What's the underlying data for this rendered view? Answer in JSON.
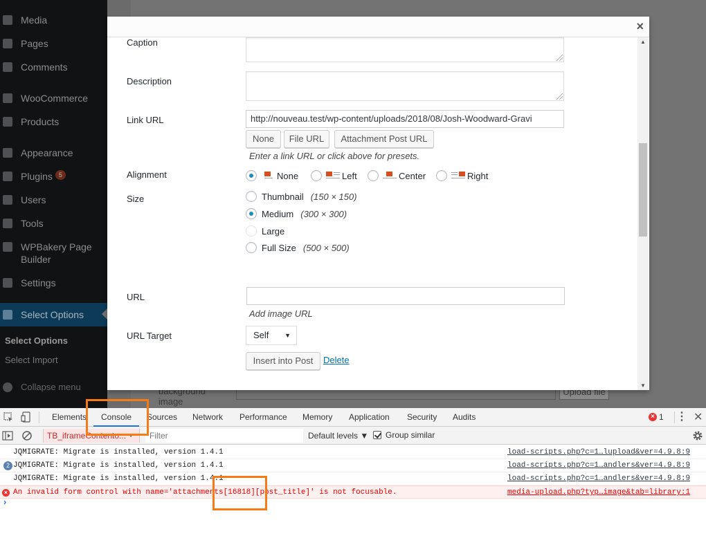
{
  "sidebar": {
    "items": [
      {
        "label": "Media"
      },
      {
        "label": "Pages"
      },
      {
        "label": "Comments"
      },
      {
        "label": "WooCommerce"
      },
      {
        "label": "Products"
      },
      {
        "label": "Appearance"
      },
      {
        "label": "Plugins",
        "badge": "5"
      },
      {
        "label": "Users"
      },
      {
        "label": "Tools"
      },
      {
        "label": "WPBakery Page Builder"
      },
      {
        "label": "Settings"
      },
      {
        "label": "Select Options"
      }
    ],
    "submenu": [
      "Select Options",
      "Select Import"
    ],
    "collapse": "Collapse menu"
  },
  "background": {
    "field_label": "background image",
    "upload_label": "Upload file"
  },
  "modal": {
    "close_glyph": "×",
    "caption_label": "Caption",
    "description_label": "Description",
    "link_url_label": "Link URL",
    "link_url_value": "http://nouveau.test/wp-content/uploads/2018/08/Josh-Woodward-Gravi",
    "link_buttons": [
      "None",
      "File URL",
      "Attachment Post URL"
    ],
    "link_help": "Enter a link URL or click above for presets.",
    "alignment_label": "Alignment",
    "alignment_options": [
      "None",
      "Left",
      "Center",
      "Right"
    ],
    "alignment_selected": "None",
    "size_label": "Size",
    "size_options": [
      {
        "label": "Thumbnail",
        "dims": "(150 × 150)",
        "checked": false,
        "disabled": false
      },
      {
        "label": "Medium",
        "dims": "(300 × 300)",
        "checked": true,
        "disabled": false
      },
      {
        "label": "Large",
        "dims": "",
        "checked": false,
        "disabled": true
      },
      {
        "label": "Full Size",
        "dims": "(500 × 500)",
        "checked": false,
        "disabled": false
      }
    ],
    "url_label": "URL",
    "url_help": "Add image URL",
    "url_target_label": "URL Target",
    "url_target_value": "Self",
    "insert_button": "Insert into Post",
    "delete_link": "Delete"
  },
  "devtools": {
    "tabs": [
      "Elements",
      "Console",
      "Sources",
      "Network",
      "Performance",
      "Memory",
      "Application",
      "Security",
      "Audits"
    ],
    "active_tab": "Console",
    "error_count": "1",
    "context": "TB_iframeContento...",
    "filter_placeholder": "Filter",
    "levels": "Default levels ▼",
    "group_similar": "Group similar",
    "lines": [
      {
        "type": "log",
        "count": "",
        "message": "JQMIGRATE: Migrate is installed, version 1.4.1",
        "source": "load-scripts.php?c=1…lupload&ver=4.9.8:9"
      },
      {
        "type": "log",
        "count": "2",
        "message": "JQMIGRATE: Migrate is installed, version 1.4.1",
        "source": "load-scripts.php?c=1…andlers&ver=4.9.8:9"
      },
      {
        "type": "log",
        "count": "",
        "message": "JQMIGRATE: Migrate is installed, version 1.4.1",
        "source": "load-scripts.php?c=1…andlers&ver=4.9.8:9"
      },
      {
        "type": "error",
        "count": "",
        "message": "An invalid form control with name='attachments[16818][post_title]' is not focusable.",
        "source": "media-upload.php?typ…image&tab=library:1"
      }
    ],
    "prompt": "›"
  },
  "colors": {
    "annotation": "#f57b16",
    "accent": "#1e8cbe",
    "error": "#e00000"
  }
}
